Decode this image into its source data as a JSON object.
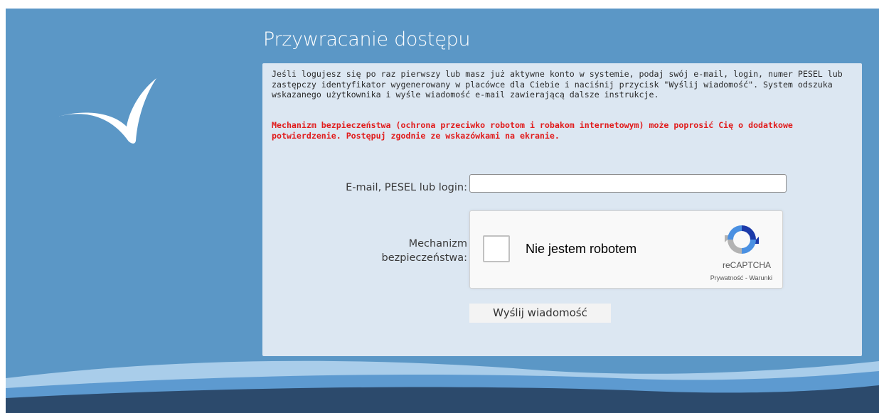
{
  "page": {
    "title": "Przywracanie dostępu",
    "colors": {
      "background": "#5b97c6",
      "panel": "#dce7f2",
      "warning": "#e11b1b",
      "footer_dark": "#2c4a6c"
    },
    "logo_icon": "checkmark-swoosh-icon"
  },
  "form": {
    "intro": "Jeśli logujesz się po raz pierwszy lub masz już aktywne konto w systemie, podaj swój e-mail, login, numer PESEL lub zastępczy identyfikator wygenerowany w placówce dla Ciebie i naciśnij przycisk \"Wyślij wiadomość\". System odszuka wskazanego użytkownika i wyśle wiadomość e-mail zawierającą dalsze instrukcje.",
    "warning": "Mechanizm bezpieczeństwa (ochrona przeciwko robotom i robakom internetowym) może poprosić Cię o dodatkowe potwierdzenie. Postępuj zgodnie ze wskazówkami na ekranie.",
    "email_label": "E-mail, PESEL lub login:",
    "email_value": "",
    "security_label_line1": "Mechanizm",
    "security_label_line2": "bezpieczeństwa:",
    "send_button": "Wyślij wiadomość"
  },
  "captcha": {
    "checkbox_label": "Nie jestem robotem",
    "brand": "reCAPTCHA",
    "privacy_link": "Prywatność",
    "separator": " - ",
    "terms_link": "Warunki",
    "icon": "recaptcha-logo-icon"
  }
}
